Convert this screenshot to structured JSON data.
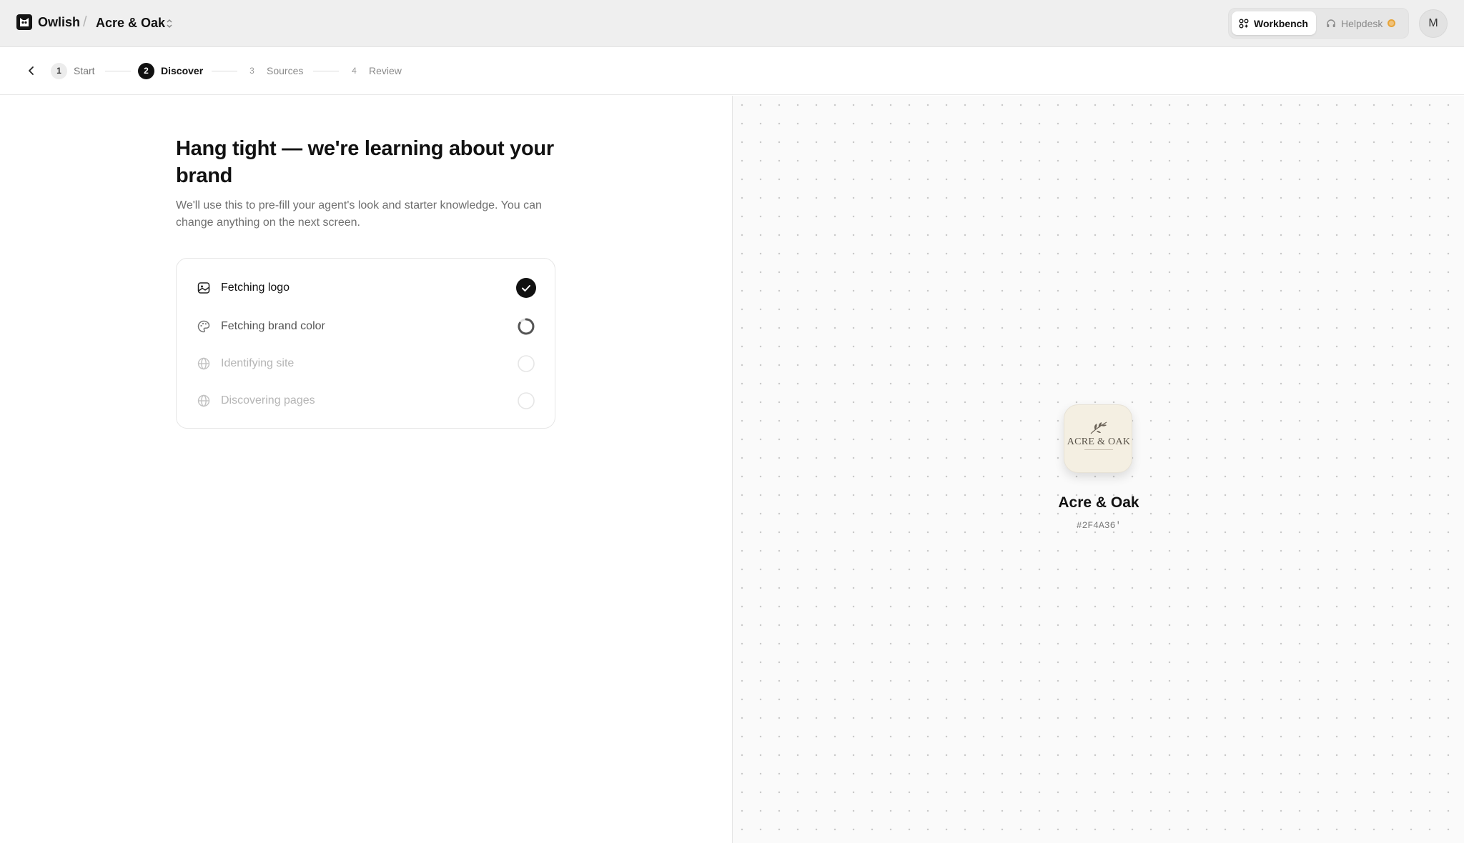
{
  "app": {
    "name": "Owlish"
  },
  "breadcrumb": {
    "separator": "/",
    "workspace": "Acre & Oak"
  },
  "header": {
    "modes": [
      {
        "label": "Workbench",
        "icon": "grid-icon",
        "active": true
      },
      {
        "label": "Helpdesk",
        "icon": "headset-icon",
        "active": false,
        "badge_color": "#E6A43A"
      }
    ],
    "avatar_initial": "M"
  },
  "stepper": {
    "steps": [
      {
        "number": "1",
        "label": "Start",
        "state": "done"
      },
      {
        "number": "2",
        "label": "Discover",
        "state": "current"
      },
      {
        "number": "3",
        "label": "Sources",
        "state": "future"
      },
      {
        "number": "4",
        "label": "Review",
        "state": "future"
      }
    ]
  },
  "main": {
    "title": "Hang tight — we're learning about your brand",
    "subtitle": "We'll use this to pre-fill your agent's look and starter knowledge. You can change anything on the next screen.",
    "tasks": [
      {
        "label": "Fetching logo",
        "icon": "image-icon",
        "status": "done"
      },
      {
        "label": "Fetching brand color",
        "icon": "palette-icon",
        "status": "in-progress"
      },
      {
        "label": "Identifying site",
        "icon": "globe-icon",
        "status": "pending"
      },
      {
        "label": "Discovering pages",
        "icon": "globe-icon",
        "status": "pending"
      }
    ]
  },
  "preview": {
    "logo_wordmark": "ACRE & OAK",
    "company_name": "Acre & Oak",
    "brand_color": "#2F4A36'"
  }
}
